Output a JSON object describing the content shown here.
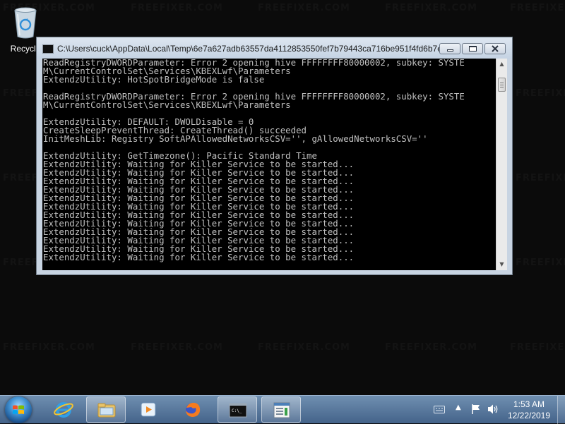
{
  "desktop": {
    "watermark": "FREEFIXER.COM",
    "recycle_bin_label": "Recycle"
  },
  "window": {
    "title": "C:\\Users\\cuck\\AppData\\Local\\Temp\\6e7a627adb63557da4112853550fef7b79443ca716be951f4fd6b7e...",
    "buttons": {
      "minimize": "minimize",
      "maximize": "maximize",
      "close": "close"
    },
    "console_lines": [
      "ReadRegistryDWORDParameter: Error 2 opening hive FFFFFFFF80000002, subkey: SYSTE",
      "M\\CurrentControlSet\\Services\\KBEXLwf\\Parameters",
      "ExtendzUtility: HotSpotBridgeMode is false",
      "",
      "ReadRegistryDWORDParameter: Error 2 opening hive FFFFFFFF80000002, subkey: SYSTE",
      "M\\CurrentControlSet\\Services\\KBEXLwf\\Parameters",
      "",
      "ExtendzUtility: DEFAULT: DWOLDisable = 0",
      "CreateSleepPreventThread: CreateThread() succeeded",
      "InitMeshLib: Registry SoftAPAllowedNetworksCSV='', gAllowedNetworksCSV=''",
      "",
      "ExtendzUtility: GetTimezone(): Pacific Standard Time",
      "ExtendzUtility: Waiting for Killer Service to be started...",
      "ExtendzUtility: Waiting for Killer Service to be started...",
      "ExtendzUtility: Waiting for Killer Service to be started...",
      "ExtendzUtility: Waiting for Killer Service to be started...",
      "ExtendzUtility: Waiting for Killer Service to be started...",
      "ExtendzUtility: Waiting for Killer Service to be started...",
      "ExtendzUtility: Waiting for Killer Service to be started...",
      "ExtendzUtility: Waiting for Killer Service to be started...",
      "ExtendzUtility: Waiting for Killer Service to be started...",
      "ExtendzUtility: Waiting for Killer Service to be started...",
      "ExtendzUtility: Waiting for Killer Service to be started...",
      "ExtendzUtility: Waiting for Killer Service to be started..."
    ]
  },
  "taskbar": {
    "clock_time": "1:53 AM",
    "clock_date": "12/22/2019",
    "apps": [
      {
        "name": "internet-explorer",
        "active": false
      },
      {
        "name": "file-explorer",
        "active": true
      },
      {
        "name": "media-player",
        "active": false
      },
      {
        "name": "firefox",
        "active": false
      },
      {
        "name": "command-prompt",
        "active": true
      },
      {
        "name": "program-window",
        "active": true
      }
    ],
    "colors": {
      "taskbar_top": "#6f8fb1",
      "taskbar_bottom": "#44638a"
    }
  }
}
